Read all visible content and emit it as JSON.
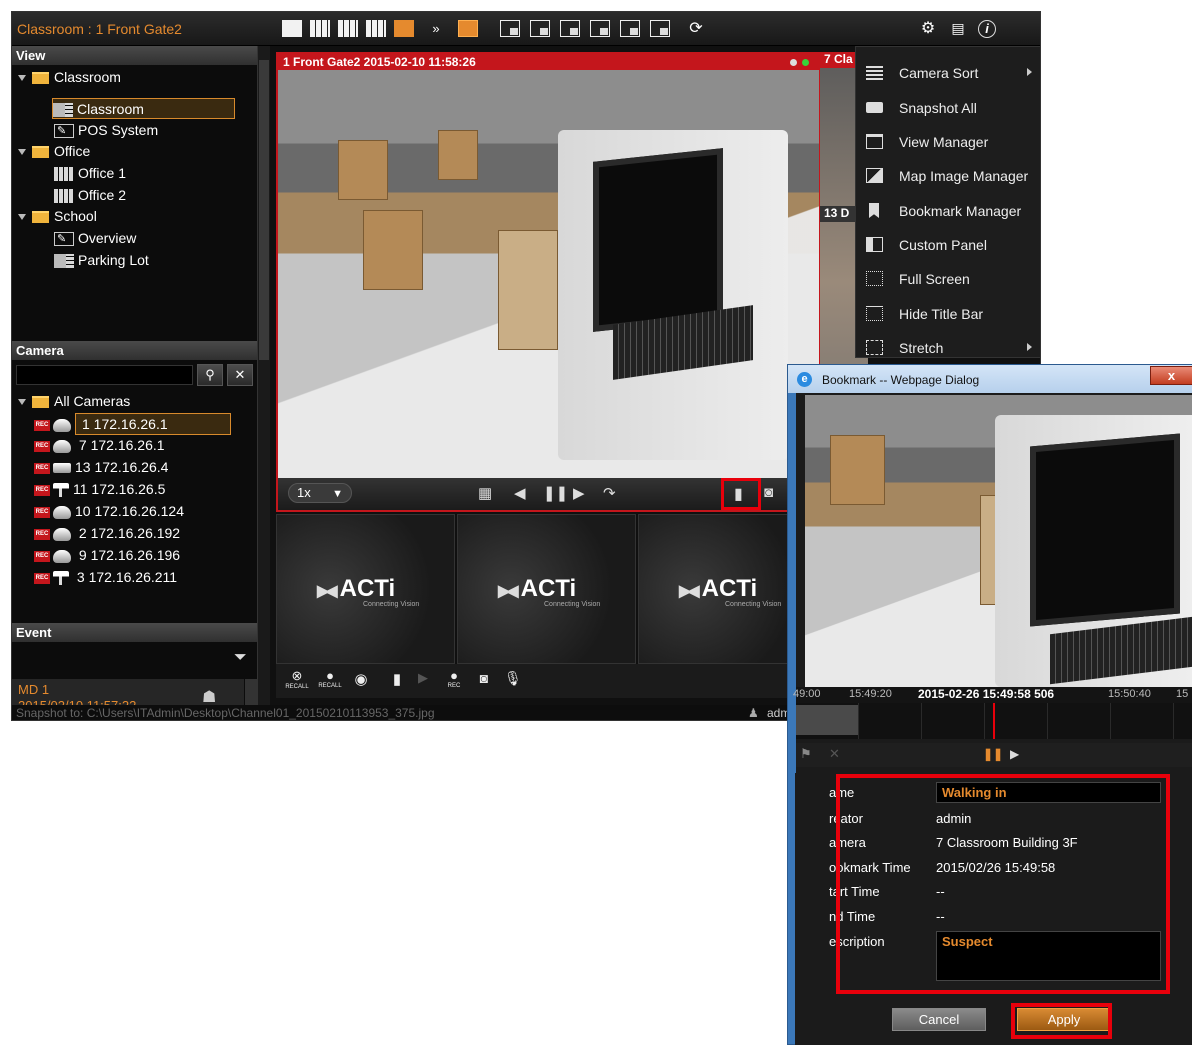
{
  "app": {
    "title": "Classroom : 1 Front Gate2",
    "toolbar_more": "»",
    "status_bar": "Snapshot to: C:\\Users\\ITAdmin\\Desktop\\Channel01_20150210113953_375.jpg",
    "user": "adm"
  },
  "view_panel": {
    "header": "View",
    "tree": [
      {
        "label": "Classroom",
        "type": "folder"
      },
      {
        "label": "Classroom",
        "type": "layout",
        "selected": true
      },
      {
        "label": "POS System",
        "type": "emap"
      },
      {
        "label": "Office",
        "type": "folder"
      },
      {
        "label": "Office 1",
        "type": "layout"
      },
      {
        "label": "Office 2",
        "type": "layout"
      },
      {
        "label": "School",
        "type": "folder"
      },
      {
        "label": "Overview",
        "type": "emap"
      },
      {
        "label": "Parking Lot",
        "type": "layout"
      }
    ]
  },
  "camera_panel": {
    "header": "Camera",
    "search_value": "",
    "root": "All Cameras",
    "rec_badge": "REC",
    "cameras": [
      {
        "label": "1 172.16.26.1",
        "selected": true
      },
      {
        "label": "7 172.16.26.1"
      },
      {
        "label": "13 172.16.26.4"
      },
      {
        "label": "11 172.16.26.5"
      },
      {
        "label": "10 172.16.26.124"
      },
      {
        "label": "2 172.16.26.192"
      },
      {
        "label": "9 172.16.26.196"
      },
      {
        "label": "3 172.16.26.211"
      }
    ]
  },
  "event_panel": {
    "header": "Event",
    "event_name": "MD 1",
    "event_time": "2015/02/10 11:57:22"
  },
  "video": {
    "title": "1 Front Gate2   2015-02-10 11:58:26",
    "speed": "1x",
    "strip_title_1": "7 Cla",
    "strip_title_2": "13 D",
    "thumb_logo": "ACTi",
    "thumb_tagline": "Connecting Vision",
    "bottom_labels": [
      "RECALL",
      "RECALL",
      "REC"
    ]
  },
  "menu": {
    "items": [
      {
        "label": "Camera Sort",
        "icon": "list-icon",
        "submenu": true
      },
      {
        "label": "Snapshot All",
        "icon": "camera-icon"
      },
      {
        "label": "View Manager",
        "icon": "window-icon"
      },
      {
        "label": "Map Image Manager",
        "icon": "image-icon"
      },
      {
        "label": "Bookmark Manager",
        "icon": "bookmark-icon"
      },
      {
        "label": "Custom Panel",
        "icon": "panel-icon"
      },
      {
        "label": "Full Screen",
        "icon": "fullscreen-icon"
      },
      {
        "label": "Hide Title Bar",
        "icon": "titlebar-icon"
      },
      {
        "label": "Stretch",
        "icon": "stretch-icon",
        "submenu": true
      }
    ]
  },
  "dialog": {
    "title": "Bookmark -- Webpage Dialog",
    "close": "x",
    "time_left": "49:00",
    "time_mid_left": "15:49:20",
    "time_current": "2015-02-26 15:49:58 506",
    "time_right": "15:50:40",
    "time_far_right": "15",
    "fields": {
      "name_label": "ame",
      "name_value": "Walking in",
      "creator_label": "reator",
      "creator_value": "admin",
      "camera_label": "amera",
      "camera_value": "7 Classroom Building 3F",
      "bookmark_time_label": "ookmark Time",
      "bookmark_time_value": "2015/02/26 15:49:58",
      "start_time_label": "tart Time",
      "start_time_value": "--",
      "end_time_label": "nd Time",
      "end_time_value": "--",
      "description_label": "escription",
      "description_value": "Suspect"
    },
    "cancel": "Cancel",
    "apply": "Apply"
  },
  "colors": {
    "accent_orange": "#e58a2e",
    "highlight_red": "#e8000b",
    "live_red": "#c4161c"
  }
}
